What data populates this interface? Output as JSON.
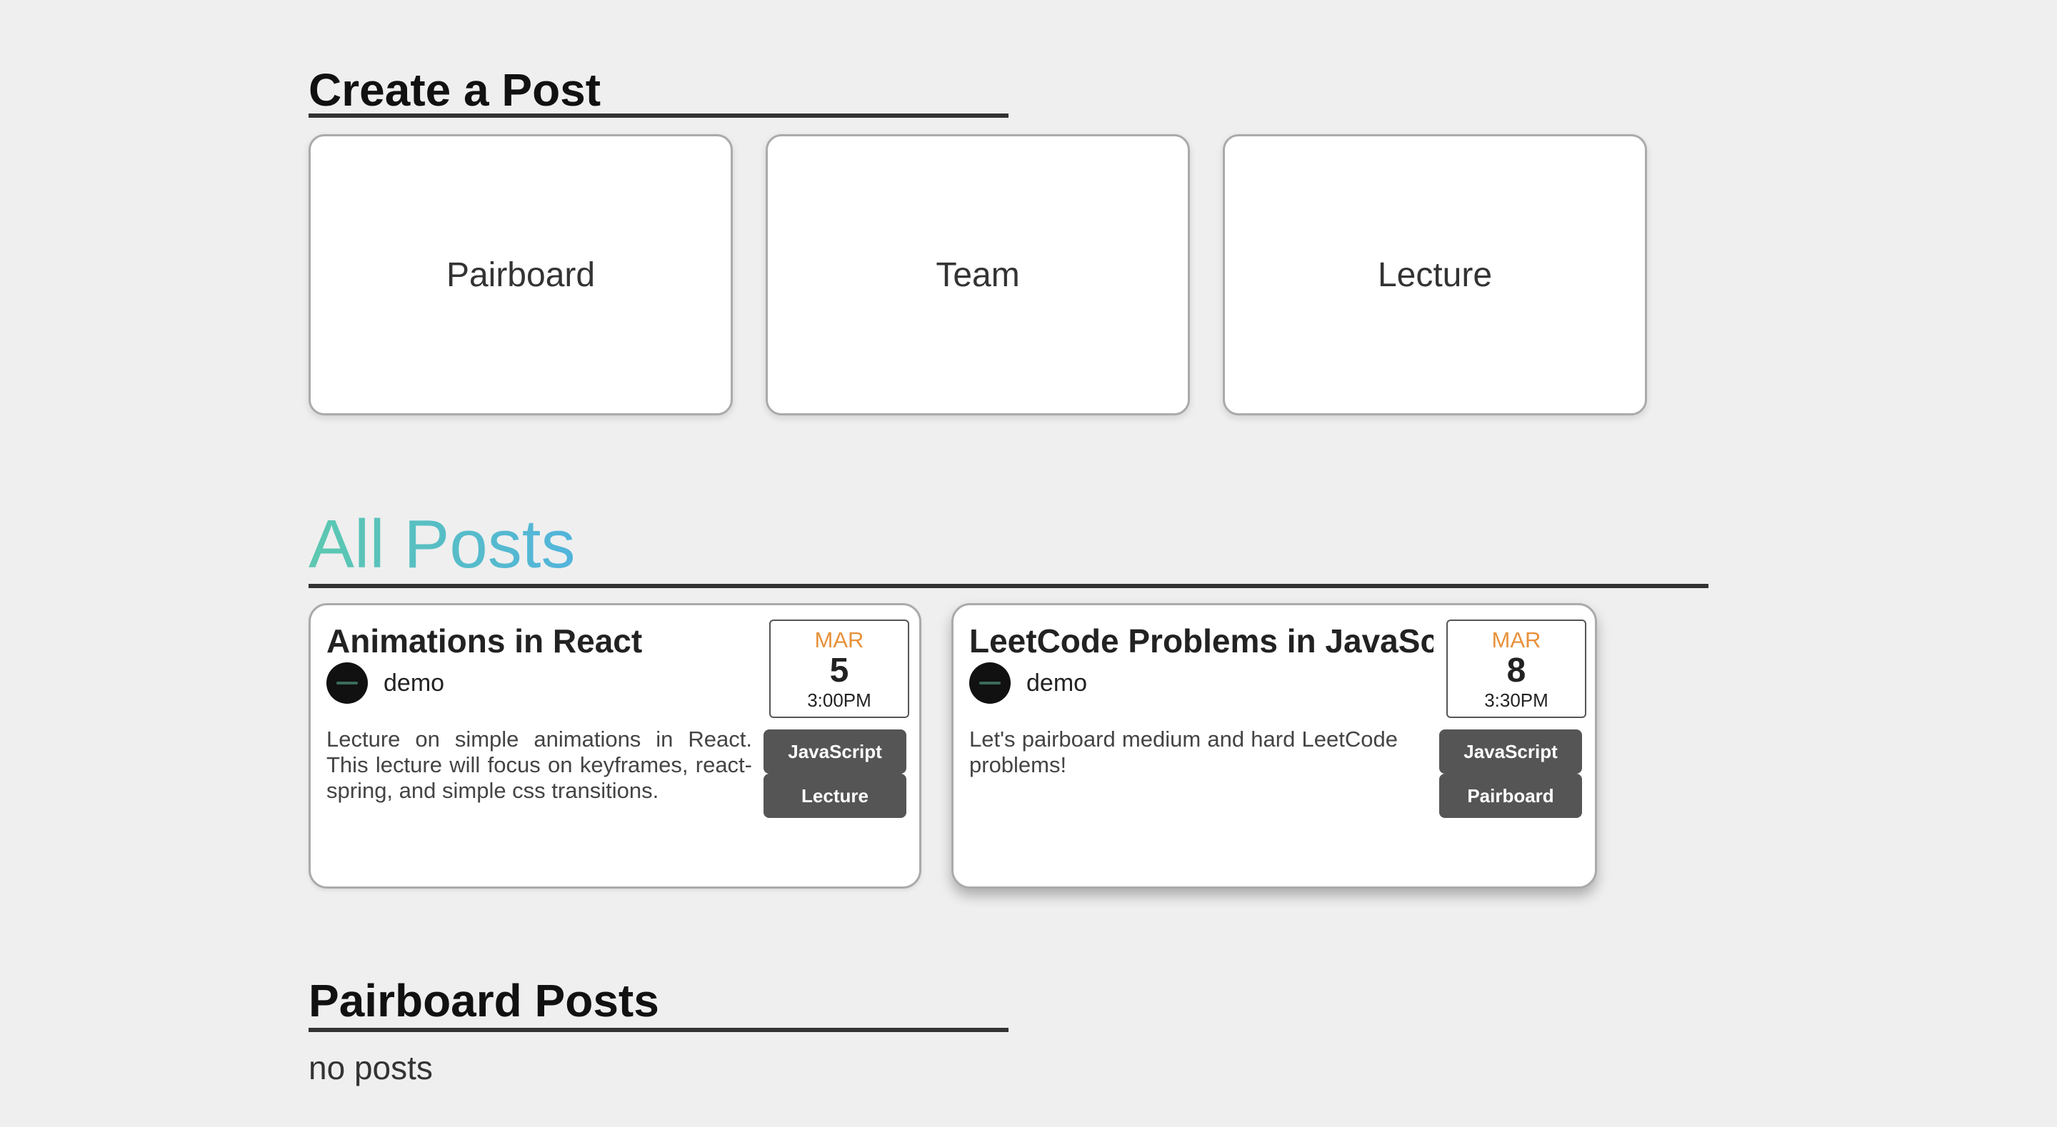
{
  "create_section": {
    "title": "Create a Post",
    "cards": [
      {
        "label": "Pairboard"
      },
      {
        "label": "Team"
      },
      {
        "label": "Lecture"
      }
    ]
  },
  "all_posts_section": {
    "title": "All Posts",
    "posts": [
      {
        "title": "Animations in React",
        "author": "demo",
        "description": "Lecture on simple animations in React. This lecture will focus on keyframes, react-spring, and simple css transitions.",
        "date": {
          "month": "MAR",
          "day": "5",
          "time": "3:00PM"
        },
        "tags": [
          "JavaScript",
          "Lecture"
        ]
      },
      {
        "title": "LeetCode Problems in JavaScr",
        "author": "demo",
        "description": "Let's pairboard medium and hard LeetCode problems!",
        "date": {
          "month": "MAR",
          "day": "8",
          "time": "3:30PM"
        },
        "tags": [
          "JavaScript",
          "Pairboard"
        ]
      }
    ]
  },
  "pairboard_section": {
    "title": "Pairboard Posts",
    "empty_text": "no posts"
  },
  "colors": {
    "background": "#efefef",
    "accent_gradient_start": "#5cc8b0",
    "accent_gradient_end": "#52b4dc",
    "date_month": "#e8913a",
    "tag_background": "#555555"
  }
}
